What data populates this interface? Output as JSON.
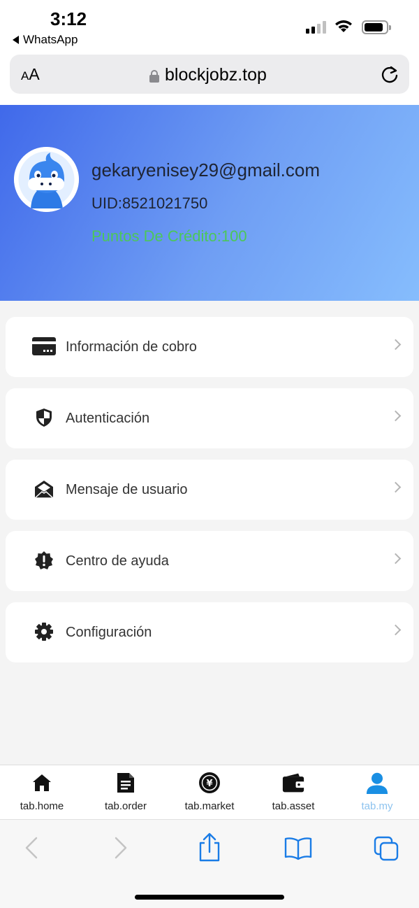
{
  "status_bar": {
    "time": "3:12",
    "back_app": "WhatsApp"
  },
  "browser": {
    "text_size_small": "A",
    "text_size_large": "A",
    "url": "blockjobz.top"
  },
  "profile": {
    "email": "gekaryenisey29@gmail.com",
    "uid": "UID:8521021750",
    "credit": "Puntos De Crédito:100"
  },
  "menu": {
    "items": [
      {
        "label": "Información de cobro",
        "icon": "credit-card-icon"
      },
      {
        "label": "Autenticación",
        "icon": "shield-icon"
      },
      {
        "label": "Mensaje de usuario",
        "icon": "envelope-open-icon"
      },
      {
        "label": "Centro de ayuda",
        "icon": "alert-badge-icon"
      },
      {
        "label": "Configuración",
        "icon": "gear-icon"
      }
    ]
  },
  "tabs": [
    {
      "label": "tab.home",
      "icon": "home-icon"
    },
    {
      "label": "tab.order",
      "icon": "document-icon"
    },
    {
      "label": "tab.market",
      "icon": "yen-coin-icon"
    },
    {
      "label": "tab.asset",
      "icon": "wallet-icon"
    },
    {
      "label": "tab.my",
      "icon": "user-icon",
      "active": true
    }
  ],
  "colors": {
    "header_gradient_start": "#4069ea",
    "header_gradient_end": "#86bdfd",
    "credit_text": "#4cc75a",
    "active_tab": "#8dc3ef",
    "safari_tint": "#1a7ce6"
  }
}
